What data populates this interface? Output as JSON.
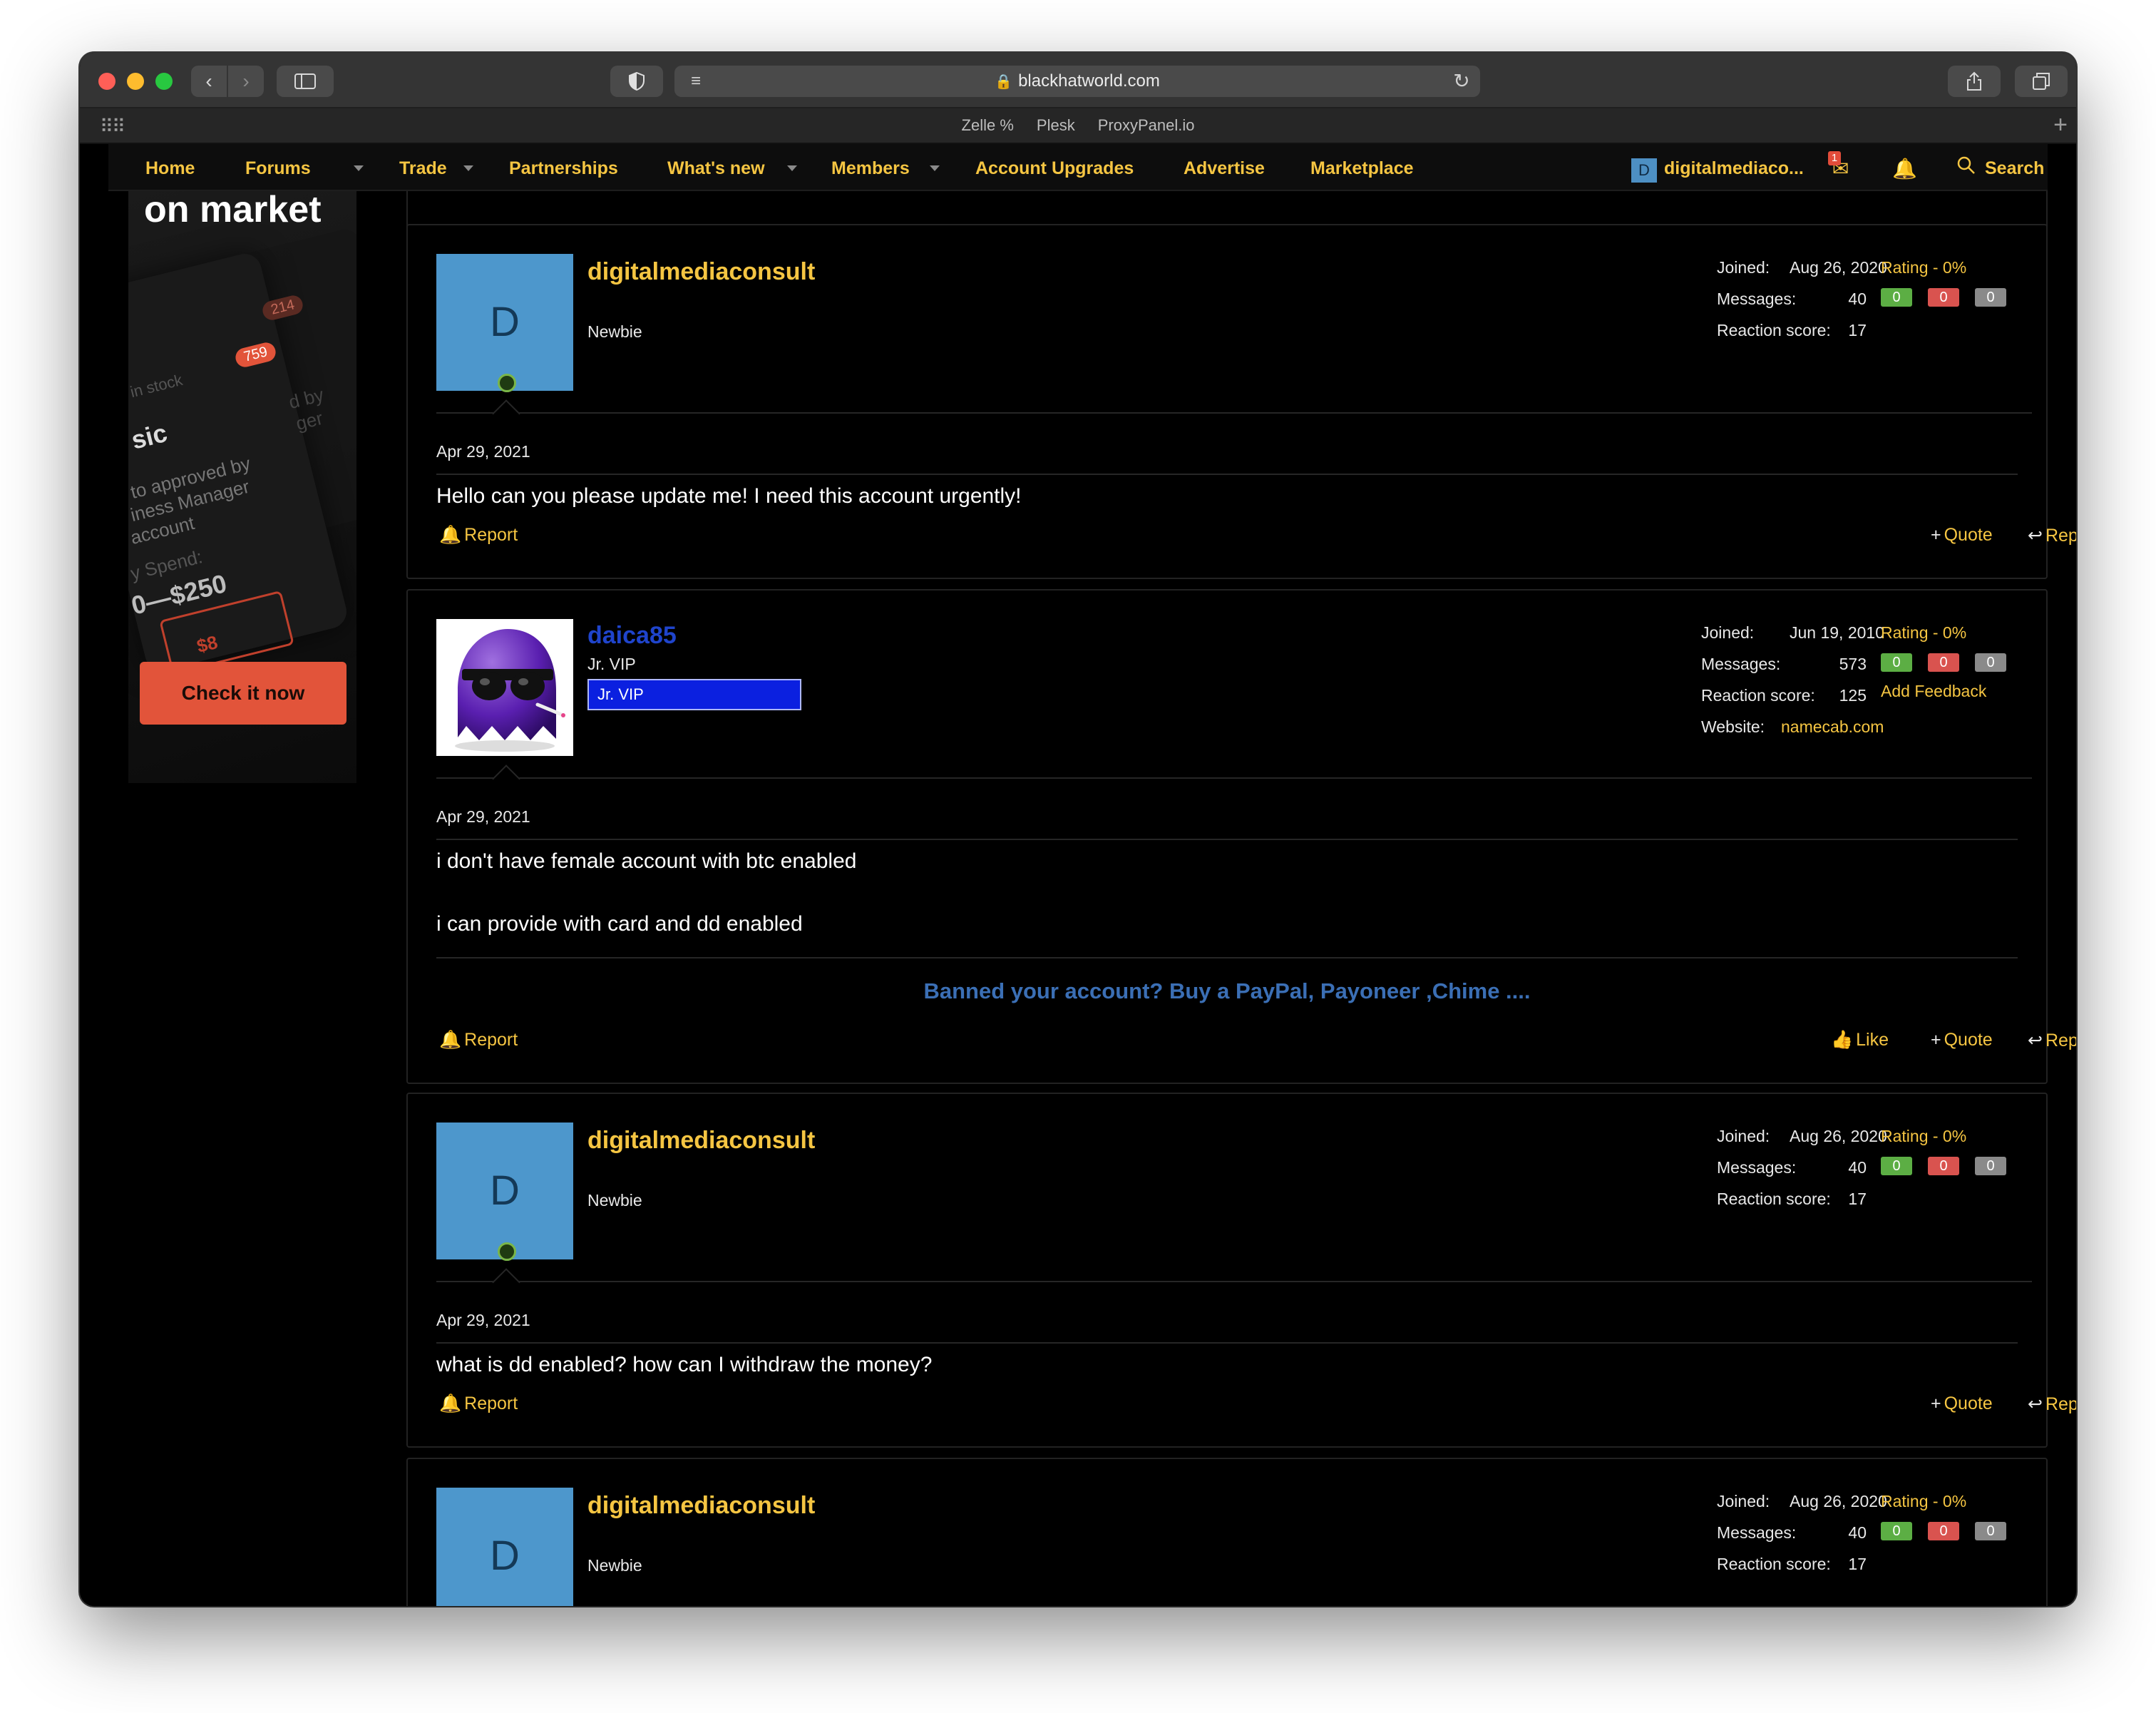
{
  "browser": {
    "url": "blackhatworld.com",
    "favorites": [
      "Zelle %",
      "Plesk",
      "ProxyPanel.io"
    ]
  },
  "nav": {
    "items": [
      "Home",
      "Forums",
      "Trade",
      "Partnerships",
      "What's new",
      "Members",
      "Account Upgrades",
      "Advertise",
      "Marketplace"
    ],
    "user_initial": "D",
    "username": "digitalmediaco...",
    "inbox_count": "1",
    "search": "Search"
  },
  "ad": {
    "title": "on market",
    "lines": [
      "in stock",
      "759",
      "214",
      "sic",
      "to approved by",
      "iness Manager",
      "account",
      "y Spend:",
      "0—$250",
      "$8",
      "d by",
      "ger"
    ],
    "cta": "Check it now"
  },
  "labels": {
    "joined": "Joined:",
    "messages": "Messages:",
    "reaction": "Reaction score:",
    "website": "Website:",
    "rating": "Rating - 0%",
    "report": "Report",
    "quote": "Quote",
    "reply": "Reply",
    "like": "Like",
    "add_feedback": "Add Feedback"
  },
  "posts": [
    {
      "avatar_initial": "D",
      "username": "digitalmediaconsult",
      "user_title": "Newbie",
      "joined": "Aug 26, 2020",
      "messages": "40",
      "reaction": "17",
      "ratings": [
        "0",
        "0",
        "0"
      ],
      "date": "Apr 29, 2021",
      "body": "Hello can you please update me! I need this account urgently!"
    },
    {
      "username": "daica85",
      "user_title": "Jr. VIP",
      "banner": "Jr. VIP",
      "joined": "Jun 19, 2010",
      "messages": "573",
      "reaction": "125",
      "website": "namecab.com",
      "ratings": [
        "0",
        "0",
        "0"
      ],
      "date": "Apr 29, 2021",
      "body_lines": [
        "i don't have female account with btc enabled",
        "i can provide with card and dd enabled"
      ],
      "signature": "Banned your account? Buy a PayPal, Payoneer ,Chime ...."
    },
    {
      "avatar_initial": "D",
      "username": "digitalmediaconsult",
      "user_title": "Newbie",
      "joined": "Aug 26, 2020",
      "messages": "40",
      "reaction": "17",
      "ratings": [
        "0",
        "0",
        "0"
      ],
      "date": "Apr 29, 2021",
      "body": "what is dd enabled? how can I withdraw the money?"
    },
    {
      "avatar_initial": "D",
      "username": "digitalmediaconsult",
      "user_title": "Newbie",
      "joined": "Aug 26, 2020",
      "messages": "40",
      "reaction": "17",
      "ratings": [
        "0",
        "0",
        "0"
      ]
    }
  ]
}
